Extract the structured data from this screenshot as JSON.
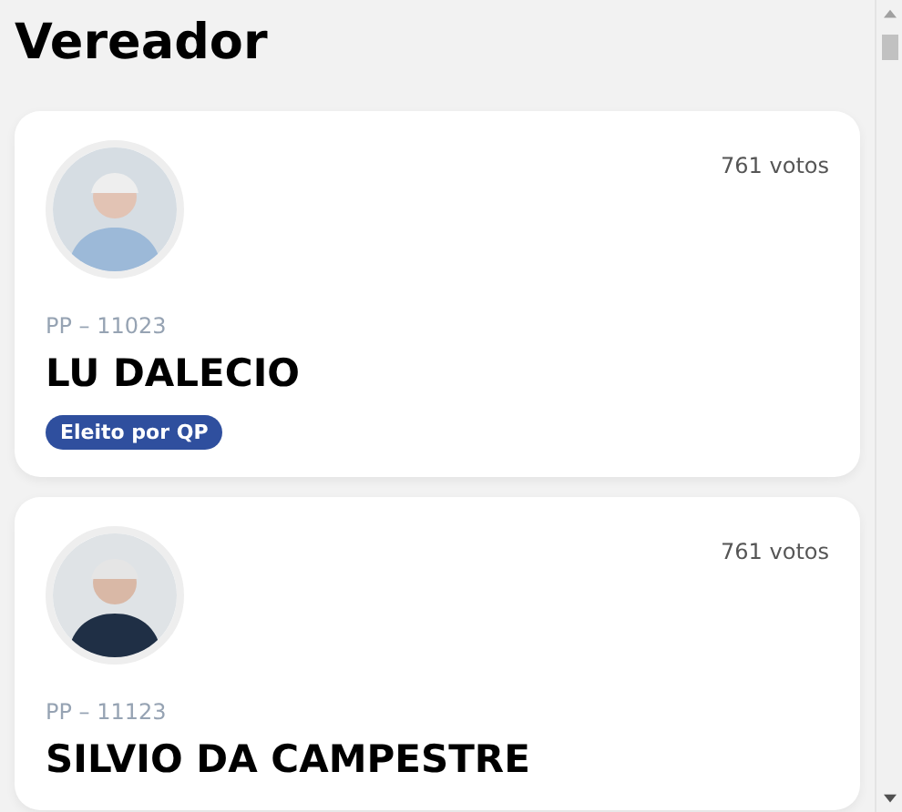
{
  "page_title": "Vereador",
  "candidates": [
    {
      "votes": "761 votos",
      "party_number": "PP – 11023",
      "name": "LU DALECIO",
      "badge": "Eleito por QP"
    },
    {
      "votes": "761 votos",
      "party_number": "PP – 11123",
      "name": "SILVIO DA CAMPESTRE"
    }
  ]
}
